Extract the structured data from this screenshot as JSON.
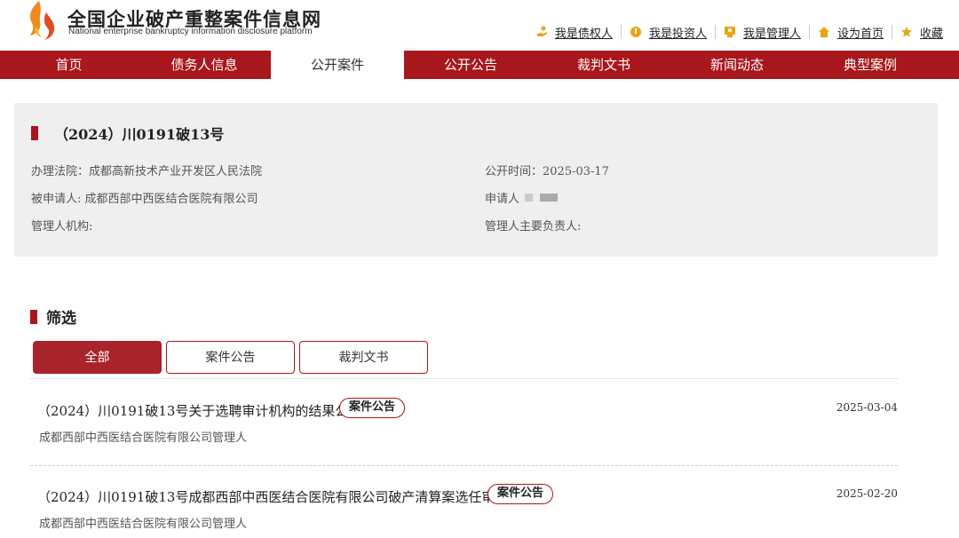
{
  "brand": {
    "title_cn": "全国企业破产重整案件信息网",
    "title_en": "National enterprise bankruptcy  information disclosure platform"
  },
  "top_links": [
    {
      "label": "我是债权人",
      "icon": "hand-coin-icon"
    },
    {
      "label": "我是投资人",
      "icon": "coin-icon"
    },
    {
      "label": "我是管理人",
      "icon": "manager-badge-icon"
    },
    {
      "label": "设为首页",
      "icon": "home-icon"
    },
    {
      "label": "收藏",
      "icon": "star-icon"
    }
  ],
  "nav": [
    {
      "label": "首页"
    },
    {
      "label": "债务人信息"
    },
    {
      "label": "公开案件",
      "active": true
    },
    {
      "label": "公开公告"
    },
    {
      "label": "裁判文书"
    },
    {
      "label": "新闻动态"
    },
    {
      "label": "典型案例"
    }
  ],
  "case": {
    "title": "（2024）川0191破13号",
    "court": "办理法院：成都高新技术产业开发区人民法院",
    "publish_time": "公开时间：2025-03-17",
    "respondent": "被申请人: 成都西部中西医结合医院有限公司",
    "applicant": "申请人",
    "administrator_org": "管理人机构:",
    "administrator_head": "管理人主要负责人:"
  },
  "filter": {
    "title": "筛选",
    "tabs": [
      {
        "label": "全部",
        "active": true
      },
      {
        "label": "案件公告"
      },
      {
        "label": "裁判文书"
      }
    ]
  },
  "notices": [
    {
      "title": "（2024）川0191破13号关于选聘审计机构的结果公示",
      "badge": "案件公告",
      "date": "2025-03-04",
      "publisher": "成都西部中西医结合医院有限公司管理人"
    },
    {
      "title": "（2024）川0191破13号成都西部中西医结合医院有限公司破产清算案选任审计..",
      "badge": "案件公告",
      "date": "2025-02-20",
      "publisher": "成都西部中西医结合医院有限公司管理人"
    }
  ],
  "colors": {
    "brand_red": "#a8171c",
    "panel_bg": "#efefef",
    "logo_orange": "#f08a1c"
  }
}
